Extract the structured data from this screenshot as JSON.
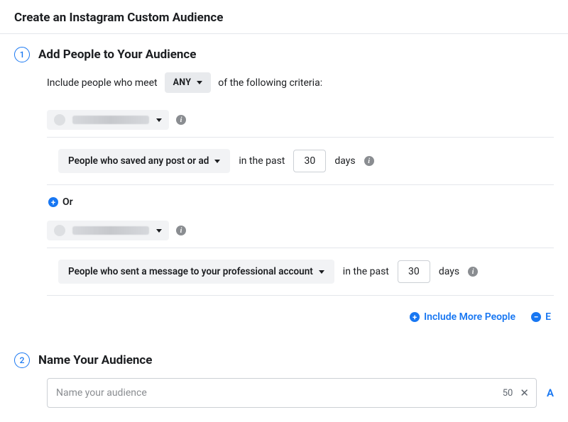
{
  "header": {
    "title": "Create an Instagram Custom Audience"
  },
  "step1": {
    "number": "1",
    "title": "Add People to Your Audience",
    "include_prefix": "Include people who meet",
    "any_label": "ANY",
    "include_suffix": "of the following criteria:",
    "or_label": "Or",
    "blocks": [
      {
        "engagement_label": "People who saved any post or ad",
        "past_prefix": "in the past",
        "days_value": "30",
        "days_suffix": "days"
      },
      {
        "engagement_label": "People who sent a message to your professional account",
        "past_prefix": "in the past",
        "days_value": "30",
        "days_suffix": "days"
      }
    ],
    "include_more": "Include More People",
    "exclude_more_fragment": "E"
  },
  "step2": {
    "number": "2",
    "title": "Name Your Audience",
    "placeholder": "Name your audience",
    "char_count": "50",
    "trailing_link_fragment": "A"
  }
}
